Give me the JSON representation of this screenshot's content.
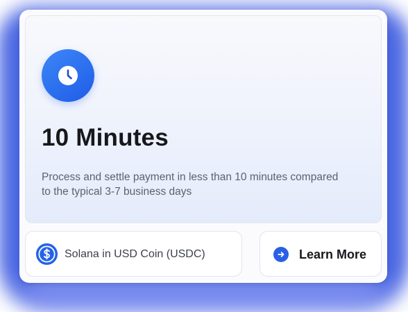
{
  "hero": {
    "icon": "clock-icon",
    "title": "10 Minutes",
    "description": "Process and settle payment in less than 10 minutes compared to the typical 3-7 business days"
  },
  "token": {
    "icon": "usdc-dollar-icon",
    "label": "Solana in USD Coin (USDC)"
  },
  "learn_more": {
    "icon": "arrow-right-icon",
    "label": "Learn More"
  },
  "colors": {
    "accent": "#2a5fe6",
    "badge_gradient_start": "#3d87f7",
    "badge_gradient_end": "#1f5ce8",
    "title_text": "#17181c",
    "body_text": "#5c6170",
    "backdrop": "#5b72e6"
  }
}
